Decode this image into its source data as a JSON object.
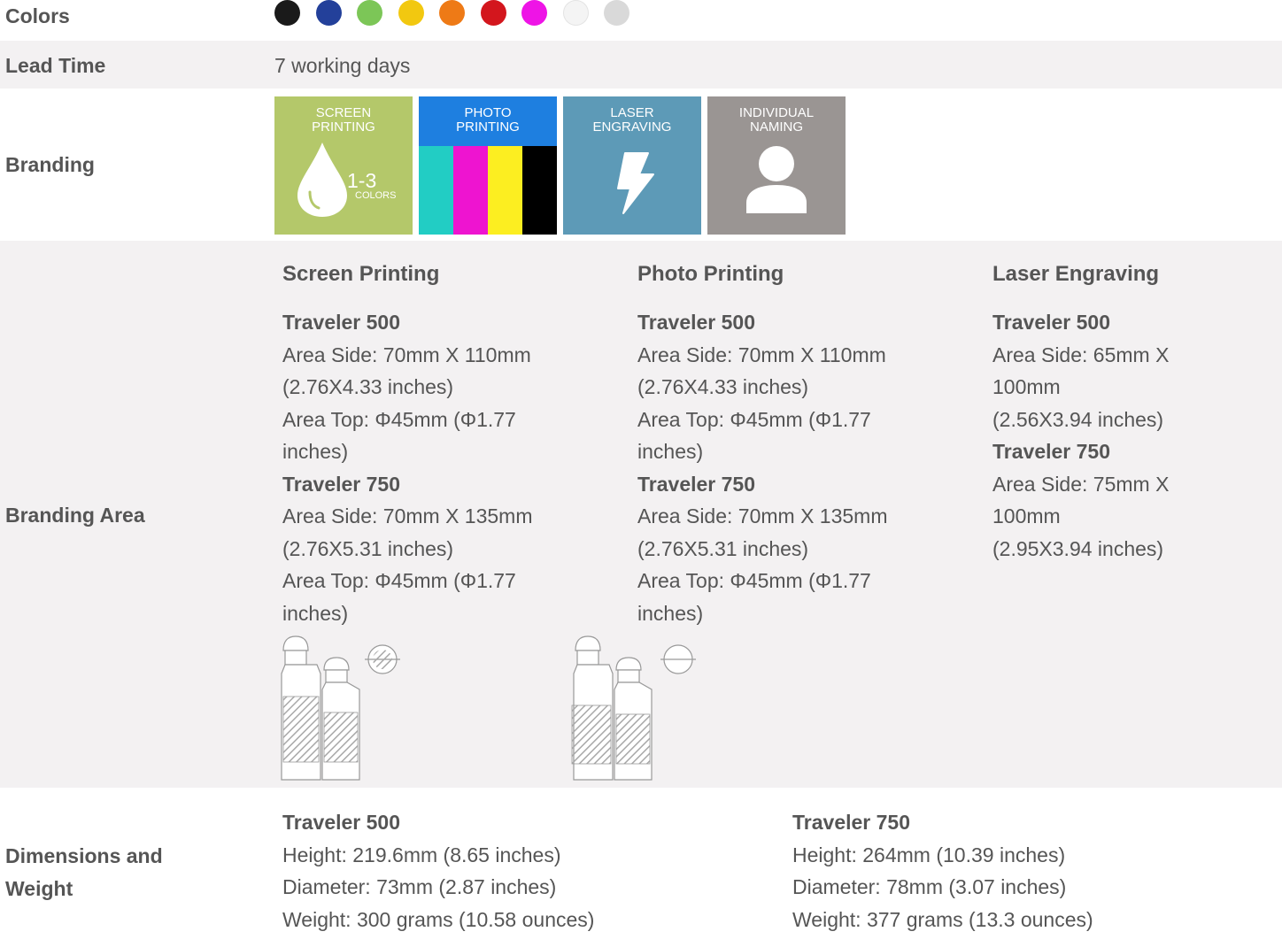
{
  "colors_row": {
    "label": "Colors",
    "swatches": [
      "#1a1a1a",
      "#23409a",
      "#7cc657",
      "#f2c810",
      "#ee7a16",
      "#d3161d",
      "#ee14e6",
      "#f4f4f4",
      "#d9d9d9"
    ]
  },
  "lead_time_row": {
    "label": "Lead Time",
    "value": "7 working days"
  },
  "branding_row": {
    "label": "Branding",
    "tiles": [
      {
        "title": "SCREEN\nPRINTING",
        "range": "1-3",
        "unit": "COLORS",
        "icon": "drop-icon"
      },
      {
        "title": "PHOTO\nPRINTING",
        "icon": "cmyk-bars-icon",
        "bars": [
          "#22cdc4",
          "#ee14d0",
          "#fcee21",
          "#000000"
        ]
      },
      {
        "title": "LASER\nENGRAVING",
        "icon": "lightning-icon"
      },
      {
        "title": "INDIVIDUAL\nNAMING",
        "icon": "person-icon"
      }
    ]
  },
  "branding_area_row": {
    "label": "Branding Area",
    "columns": [
      {
        "heading": "Screen Printing",
        "groups": [
          {
            "model": "Traveler 500",
            "lines": [
              "Area Side: 70mm X 110mm",
              "(2.76X4.33 inches)",
              "Area Top: Φ45mm (Φ1.77",
              "inches)"
            ]
          },
          {
            "model": "Traveler 750",
            "lines": [
              "Area Side: 70mm X 135mm",
              "(2.76X5.31 inches)",
              "Area Top: Φ45mm (Φ1.77",
              "inches)"
            ]
          }
        ]
      },
      {
        "heading": "Photo Printing",
        "groups": [
          {
            "model": "Traveler 500",
            "lines": [
              "Area Side: 70mm X 110mm",
              "(2.76X4.33 inches)",
              "Area Top: Φ45mm (Φ1.77",
              "inches)"
            ]
          },
          {
            "model": "Traveler 750",
            "lines": [
              "Area Side: 70mm X 135mm",
              "(2.76X5.31 inches)",
              "Area Top: Φ45mm (Φ1.77",
              "inches)"
            ]
          }
        ]
      },
      {
        "heading": "Laser Engraving",
        "groups": [
          {
            "model": "Traveler 500",
            "lines": [
              "Area Side: 65mm X",
              "100mm",
              "(2.56X3.94 inches)"
            ]
          },
          {
            "model": "Traveler 750",
            "lines": [
              "Area Side: 75mm X",
              "100mm",
              "(2.95X3.94 inches)"
            ]
          }
        ]
      }
    ]
  },
  "dimensions_row": {
    "label_line1": "Dimensions and",
    "label_line2": "Weight",
    "columns": [
      {
        "model": "Traveler 500",
        "lines": [
          "Height: 219.6mm (8.65 inches)",
          "Diameter: 73mm (2.87 inches)",
          "Weight: 300 grams (10.58 ounces)"
        ]
      },
      {
        "model": "Traveler 750",
        "lines": [
          "Height: 264mm (10.39 inches)",
          "Diameter: 78mm (3.07 inches)",
          "Weight: 377 grams (13.3 ounces)"
        ]
      }
    ]
  }
}
